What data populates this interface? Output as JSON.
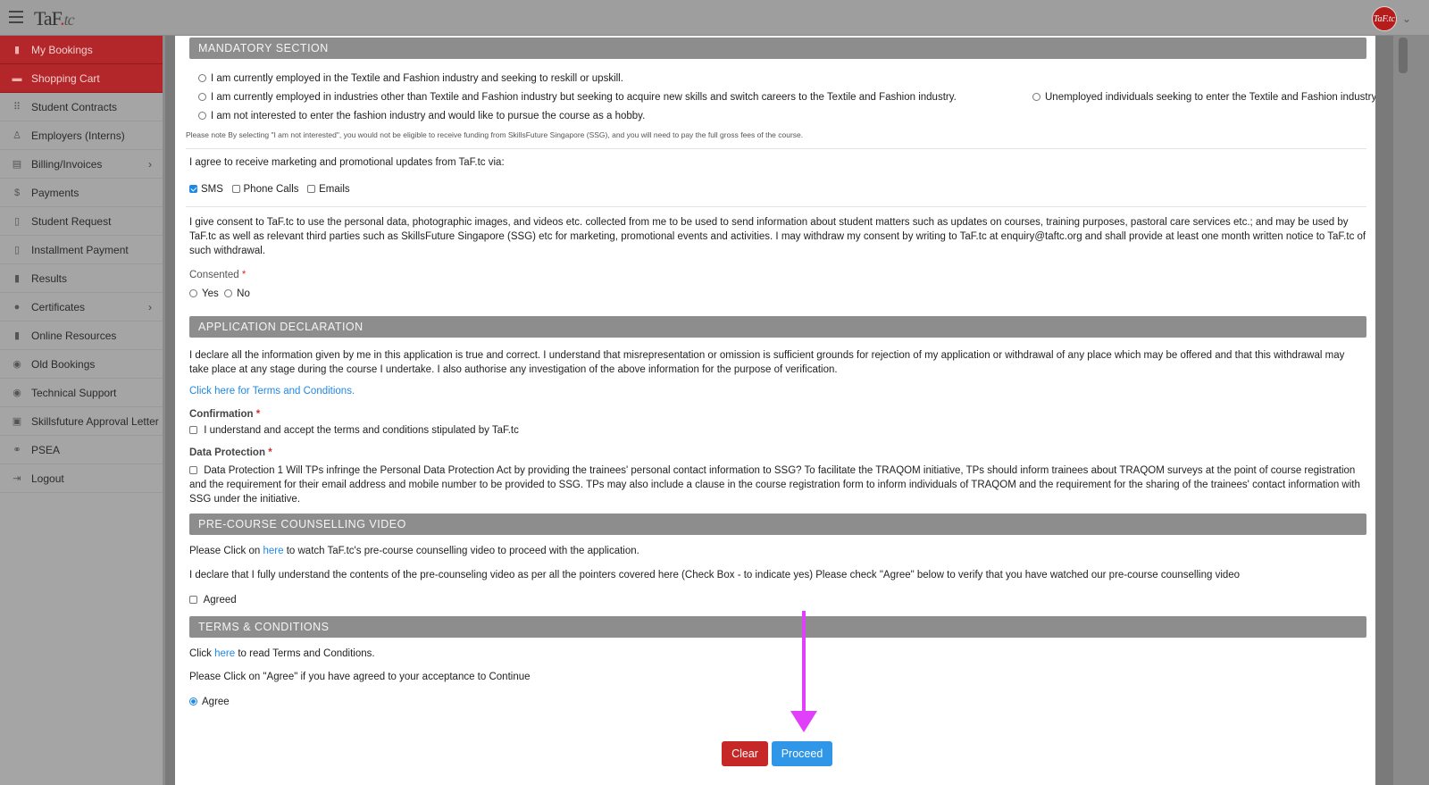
{
  "header": {
    "logo_text": "TaF",
    "logo_suffix": "tc",
    "avatar_text": "TaF.tc"
  },
  "sidebar": {
    "items": [
      {
        "label": "My Bookings",
        "icon": "book-icon"
      },
      {
        "label": "Shopping Cart",
        "icon": "cart-icon"
      },
      {
        "label": "Student Contracts",
        "icon": "grid-icon"
      },
      {
        "label": "Employers (Interns)",
        "icon": "user-icon"
      },
      {
        "label": "Billing/Invoices",
        "icon": "document-icon"
      },
      {
        "label": "Payments",
        "icon": "dollar-icon"
      },
      {
        "label": "Student Request",
        "icon": "file-icon"
      },
      {
        "label": "Installment Payment",
        "icon": "file-icon"
      },
      {
        "label": "Results",
        "icon": "file-icon"
      },
      {
        "label": "Certificates",
        "icon": "certificate-icon"
      },
      {
        "label": "Online Resources",
        "icon": "book-icon"
      },
      {
        "label": "Old Bookings",
        "icon": "history-icon"
      },
      {
        "label": "Technical Support",
        "icon": "support-icon"
      },
      {
        "label": "Skillsfuture Approval Letter",
        "icon": "image-icon"
      },
      {
        "label": "PSEA",
        "icon": "handshake-icon"
      },
      {
        "label": "Logout",
        "icon": "logout-icon"
      }
    ]
  },
  "mandatory": {
    "title": "MANDATORY SECTION",
    "options": [
      "I am currently employed in the Textile and Fashion industry and seeking to reskill or upskill.",
      "I am currently employed in industries other than Textile and Fashion industry but seeking to acquire new skills and switch careers to the Textile and Fashion industry.",
      "Unemployed individuals seeking to enter the Textile and Fashion industry.",
      "I am not interested to enter the fashion industry and would like to pursue the course as a hobby."
    ],
    "note": "Please note By selecting \"I am not interested\", you would not be eligible to receive funding from SkillsFuture Singapore (SSG), and you will need to pay the full gross fees of the course."
  },
  "marketing": {
    "prompt": "I agree to receive marketing and promotional updates from TaF.tc via:",
    "channels": [
      {
        "label": "SMS",
        "checked": true
      },
      {
        "label": "Phone Calls",
        "checked": false
      },
      {
        "label": "Emails",
        "checked": false
      }
    ]
  },
  "consent": {
    "text": "I give consent to TaF.tc to use the personal data, photographic images, and videos etc. collected from me to be used to send information about student matters such as updates on courses, training purposes, pastoral care services etc.; and may be used by TaF.tc as well as relevant third parties such as SkillsFuture Singapore (SSG) etc for marketing, promotional events and activities. I may withdraw my consent by writing to TaF.tc at enquiry@taftc.org and shall provide at least one month written notice to TaF.tc of such withdrawal.",
    "label": "Consented",
    "required_mark": "*",
    "yes_label": "Yes",
    "no_label": "No"
  },
  "declaration": {
    "title": "APPLICATION DECLARATION",
    "text": "I declare all the information given by me in this application is true and correct. I understand that misrepresentation or omission is sufficient grounds for rejection of my application or withdrawal of any place which may be offered and that this withdrawal may take place at any stage during the course I undertake. I also authorise any investigation of the above information for the purpose of verification.",
    "terms_link": "Click here for Terms and Conditions.",
    "confirmation_label": "Confirmation",
    "confirmation_text": "I understand and accept the terms and conditions stipulated by TaF.tc",
    "data_protection_label": "Data Protection",
    "data_protection_text": "Data Protection 1 Will TPs infringe the Personal Data Protection Act by providing the trainees' personal contact information to SSG? To facilitate the TRAQOM initiative, TPs should inform trainees about TRAQOM surveys at the point of course registration and the requirement for their email address and mobile number to be provided to SSG. TPs may also include a clause in the course registration form to inform individuals of TRAQOM and the requirement for the sharing of the trainees' contact information with SSG under the initiative."
  },
  "video": {
    "title": "PRE-COURSE COUNSELLING VIDEO",
    "line1_pre": "Please Click on",
    "line1_link": "here",
    "line1_post": "to watch TaF.tc's pre-course counselling video to proceed with the application.",
    "line2": "I declare that I fully understand the contents of the pre-counseling video as per all the pointers covered here (Check Box - to indicate yes) Please check \"Agree\" below to verify that you have watched our pre-course counselling video",
    "agreed_label": "Agreed"
  },
  "terms": {
    "title": "TERMS & CONDITIONS",
    "line1_pre": "Click",
    "line1_link": "here",
    "line1_post": "to read Terms and Conditions.",
    "line2": "Please Click on \"Agree\" if you have agreed to your acceptance to Continue",
    "agree_label": "Agree"
  },
  "actions": {
    "clear_label": "Clear",
    "proceed_label": "Proceed"
  },
  "colors": {
    "active_sidebar": "#b3262a",
    "section_header": "#8d8d8d",
    "link": "#1e88e5",
    "proceed": "#2f96e8",
    "clear": "#c62828",
    "annotation_arrow": "#e040fb"
  }
}
